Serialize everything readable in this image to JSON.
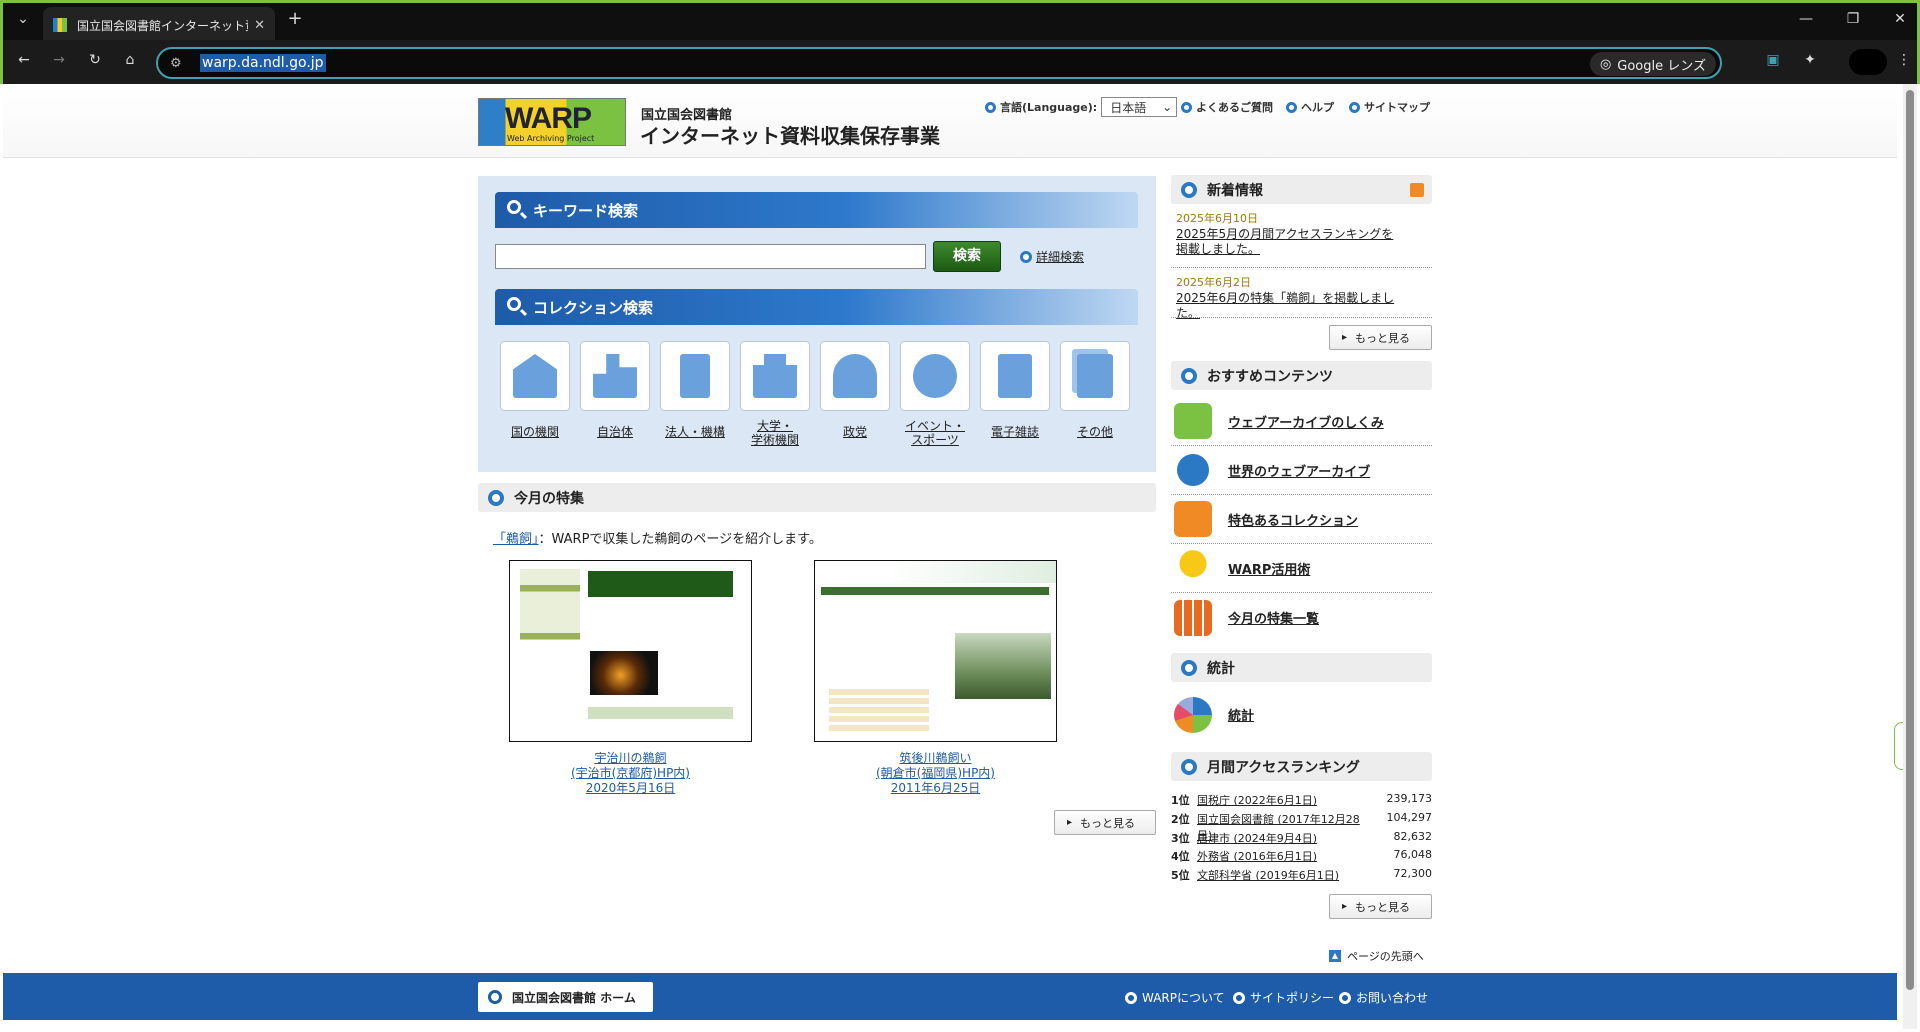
{
  "browser": {
    "tab_title": "国立国会図書館インターネット資料",
    "new_tab": "+",
    "url": "warp.da.ndl.go.jp",
    "lens_label": "Google レンズ",
    "win_min": "—",
    "win_max": "❐",
    "win_close": "✕"
  },
  "header": {
    "logo_text": "WARP",
    "logo_sub": "Web Archiving Project",
    "org": "国立国会図書館",
    "title": "インターネット資料収集保存事業",
    "lang_label": "言語(Language):",
    "lang_value": "日本語",
    "nav": [
      "よくあるご質問",
      "ヘルプ",
      "サイトマップ"
    ]
  },
  "search": {
    "keyword_title": "キーワード検索",
    "button": "検索",
    "advanced": "詳細検索",
    "collection_title": "コレクション検索",
    "collections": [
      "国の機関",
      "自治体",
      "法人・機構",
      "大学・\n学術機関",
      "政党",
      "イベント・\nスポーツ",
      "電子雑誌",
      "その他"
    ]
  },
  "feature": {
    "title": "今月の特集",
    "topic_link": "「鵜飼」",
    "topic_desc": "：WARPで収集した鵜飼のページを紹介します。",
    "items": [
      {
        "l1": "宇治川の鵜飼",
        "l2": "(宇治市(京都府)HP内)",
        "l3": "2020年5月16日"
      },
      {
        "l1": "筑後川鵜飼い",
        "l2": "(朝倉市(福岡県)HP内)",
        "l3": "2011年6月25日"
      }
    ],
    "more": "もっと見る"
  },
  "news": {
    "title": "新着情報",
    "items": [
      {
        "date": "2025年6月10日",
        "text": "2025年5月の月間アクセスランキングを掲載しました。"
      },
      {
        "date": "2025年6月2日",
        "text": "2025年6月の特集「鵜飼」を掲載しました。"
      }
    ],
    "more": "もっと見る"
  },
  "recommend": {
    "title": "おすすめコンテンツ",
    "items": [
      "ウェブアーカイブのしくみ",
      "世界のウェブアーカイブ",
      "特色あるコレクション",
      "WARP活用術",
      "今月の特集一覧"
    ]
  },
  "stats": {
    "title": "統計",
    "link": "統計"
  },
  "ranking": {
    "title": "月間アクセスランキング",
    "items": [
      {
        "rank": "1位",
        "name": "国税庁 (2022年6月1日)",
        "count": "239,173"
      },
      {
        "rank": "2位",
        "name": "国立国会図書館 (2017年12月28日)",
        "count": "104,297"
      },
      {
        "rank": "3位",
        "name": "唐津市 (2024年9月4日)",
        "count": "82,632"
      },
      {
        "rank": "4位",
        "name": "外務省 (2016年6月1日)",
        "count": "76,048"
      },
      {
        "rank": "5位",
        "name": "文部科学省 (2019年6月1日)",
        "count": "72,300"
      }
    ],
    "more": "もっと見る"
  },
  "to_top": "ページの先頭へ",
  "footer": {
    "home": "国立国会図書館 ホーム",
    "links": [
      "WARPについて",
      "サイトポリシー",
      "お問い合わせ"
    ]
  },
  "colors": {
    "brand_blue": "#1e5ba8",
    "accent_green": "#7cc242",
    "search_green": "#2f7a22"
  }
}
